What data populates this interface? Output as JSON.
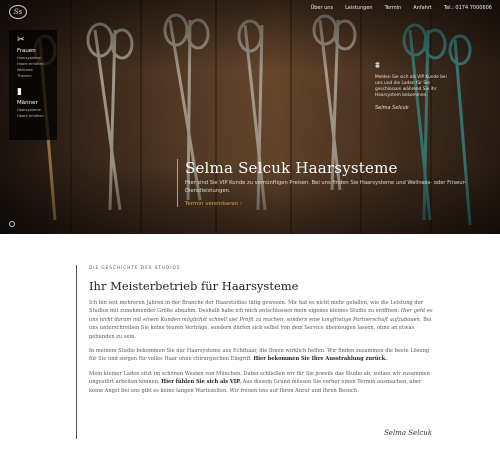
{
  "nav": {
    "logo": "Ss",
    "items": [
      "Über uns",
      "Leistungen",
      "Termin",
      "Anfahrt",
      "Tel.: 0174 7000606"
    ]
  },
  "sidemenu": {
    "frauen": {
      "title": "Frauen",
      "items": [
        "Haarsysteme",
        "Haare erhöhen",
        "Wellness",
        "Themen"
      ]
    },
    "maenner": {
      "title": "Männer",
      "items": [
        "Haarsysteme",
        "Haare erhöhen"
      ]
    }
  },
  "promo": {
    "text": "Melden Sie sich als VIP Kunde bei uns und die Laden für Sie geschlossen während Sie ihr Haarsystem bekommen.",
    "signature": "Selma Selcuk"
  },
  "hero": {
    "title": "Selma Selcuk Haarsysteme",
    "subtitle": "Hier sind Sie VIP Kunde zu vernünftigen Preisen. Bei uns finden Sie Haarsysteme und Wellness- oder Friseur-Dienstleistungen.",
    "link": "Termin vereinbaren ›"
  },
  "about": {
    "eyebrow": "DIE GESCHICHTE DES STUDIOS",
    "heading": "Ihr Meisterbetrieb für Haarsysteme",
    "p1_a": "Ich bin seit mehreren Jahren in der Branche der Haarstudios tätig gewesen. Mir hat es nicht mehr gefallen, wie die Leistung der Studios mit zunehmender Größe abnahm. Deshalb habe ich mich entschlossen mein eigenes kleines Studio zu eröffnen. ",
    "p1_em": "Hier geht es uns nicht darum mit einem Kunden möglichst schnell viel Profit zu machen, sondern eine langfristige Partnerschaft aufzubauen.",
    "p1_b": " Bei uns unterschreiben Sie keine teuren Verträge, sondern dürfen sich selbst von dem Service überzeugen lassen, ohne an etwas gebunden zu sein.",
    "p2_a": "In meinem Studio bekommen Sie nur Haarsysteme aus Echthaar, die Ihnen wirklich helfen. Wir finden zusammen die beste Lösung für Sie und sorgen für volles Haar ohne chirurgischen Eingriff. ",
    "p2_b": "Hier bekommen Sie Ihre Ausstrahlung zurück.",
    "p3_a": "Mein kleiner Laden sitzt im schönen Westen von München. Dabei schließen wir für Sie jeweils das Studio ab, sodass wir zusammen ungestört arbeiten können. ",
    "p3_b": "Hier fühlen Sie sich als VIP.",
    "p3_c": " Aus diesem Grund müssen Sie vorher einen Termin ausmachen, aber keine Angst bei uns gibt es keine langen Wartezeiten. Wir freuen uns auf Ihren Anruf und Ihren Besuch.",
    "signature": "Selma Selcuk"
  }
}
